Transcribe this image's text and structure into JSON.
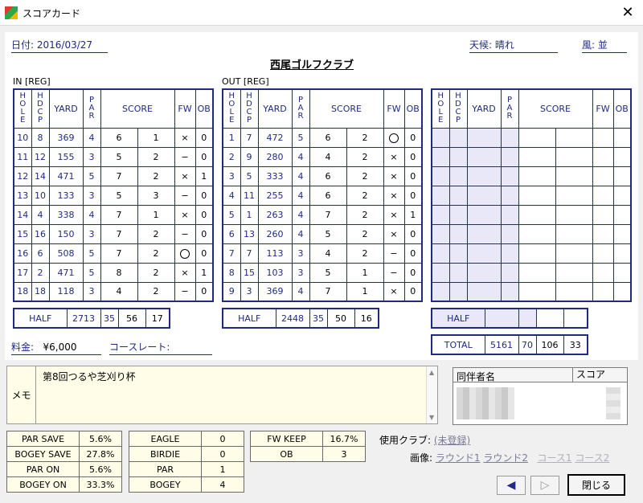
{
  "window": {
    "title": "スコアカード",
    "close": "✕"
  },
  "header": {
    "date": "日付: 2016/03/27",
    "weather": "天候: 晴れ",
    "wind": "風: 並",
    "club": "西尾ゴルフクラブ"
  },
  "sections": {
    "in": "IN [REG]",
    "out": "OUT [REG]"
  },
  "cols": {
    "hole": "HOLE",
    "hdcp": "HDCP",
    "yard": "YARD",
    "par": "PAR",
    "score": "SCORE",
    "fw": "FW",
    "ob": "OB"
  },
  "in_rows": [
    [
      "10",
      "8",
      "369",
      "4",
      "6",
      "1",
      "×",
      "0"
    ],
    [
      "11",
      "12",
      "155",
      "3",
      "5",
      "2",
      "−",
      "0"
    ],
    [
      "12",
      "14",
      "471",
      "5",
      "7",
      "2",
      "×",
      "1"
    ],
    [
      "13",
      "10",
      "133",
      "3",
      "5",
      "3",
      "−",
      "0"
    ],
    [
      "14",
      "4",
      "338",
      "4",
      "7",
      "1",
      "×",
      "0"
    ],
    [
      "15",
      "16",
      "150",
      "3",
      "7",
      "2",
      "−",
      "0"
    ],
    [
      "16",
      "6",
      "508",
      "5",
      "7",
      "2",
      "○",
      "0"
    ],
    [
      "17",
      "2",
      "471",
      "5",
      "8",
      "2",
      "×",
      "1"
    ],
    [
      "18",
      "18",
      "118",
      "3",
      "4",
      "2",
      "−",
      "0"
    ]
  ],
  "in_half": [
    "HALF",
    "2713",
    "35",
    "56",
    "17"
  ],
  "out_rows": [
    [
      "1",
      "7",
      "472",
      "5",
      "6",
      "2",
      "○",
      "0"
    ],
    [
      "2",
      "9",
      "280",
      "4",
      "4",
      "2",
      "×",
      "0"
    ],
    [
      "3",
      "5",
      "333",
      "4",
      "6",
      "2",
      "×",
      "0"
    ],
    [
      "4",
      "11",
      "255",
      "4",
      "6",
      "2",
      "×",
      "0"
    ],
    [
      "5",
      "1",
      "263",
      "4",
      "7",
      "2",
      "×",
      "1"
    ],
    [
      "6",
      "13",
      "260",
      "4",
      "5",
      "2",
      "×",
      "0"
    ],
    [
      "7",
      "7",
      "113",
      "3",
      "4",
      "2",
      "−",
      "0"
    ],
    [
      "8",
      "15",
      "103",
      "3",
      "5",
      "1",
      "−",
      "0"
    ],
    [
      "9",
      "3",
      "369",
      "4",
      "7",
      "1",
      "×",
      "0"
    ]
  ],
  "out_half": [
    "HALF",
    "2448",
    "35",
    "50",
    "16"
  ],
  "third_half": "HALF",
  "total": [
    "TOTAL",
    "5161",
    "70",
    "106",
    "33"
  ],
  "fee": {
    "label": "料金:",
    "value": "¥6,000",
    "rating": "コースレート:"
  },
  "memo": {
    "label": "メモ",
    "text": "第8回つるや芝刈り杯"
  },
  "companions": {
    "name_col": "同伴者名",
    "score_col": "スコア"
  },
  "stats1": [
    [
      "PAR SAVE",
      "5.6%"
    ],
    [
      "BOGEY SAVE",
      "27.8%"
    ],
    [
      "PAR ON",
      "5.6%"
    ],
    [
      "BOGEY ON",
      "33.3%"
    ]
  ],
  "stats2": [
    [
      "EAGLE",
      "0"
    ],
    [
      "BIRDIE",
      "0"
    ],
    [
      "PAR",
      "1"
    ],
    [
      "BOGEY",
      "4"
    ]
  ],
  "stats3": [
    [
      "FW KEEP",
      "16.7%"
    ],
    [
      "OB",
      "3"
    ]
  ],
  "club_used": {
    "label": "使用クラブ:",
    "link": "(未登録)"
  },
  "images": {
    "label": "画像:",
    "r1": "ラウンド1",
    "r2": "ラウンド2",
    "c1": "コース1",
    "c2": "コース2"
  },
  "buttons": {
    "prev": "◀",
    "next": "▷",
    "close": "閉じる"
  },
  "colors": {
    "accent": "#1f2a80",
    "birdie": "#1a8f2a",
    "memo_bg": "#fffde8",
    "blank_cell": "#e8e8f8"
  }
}
